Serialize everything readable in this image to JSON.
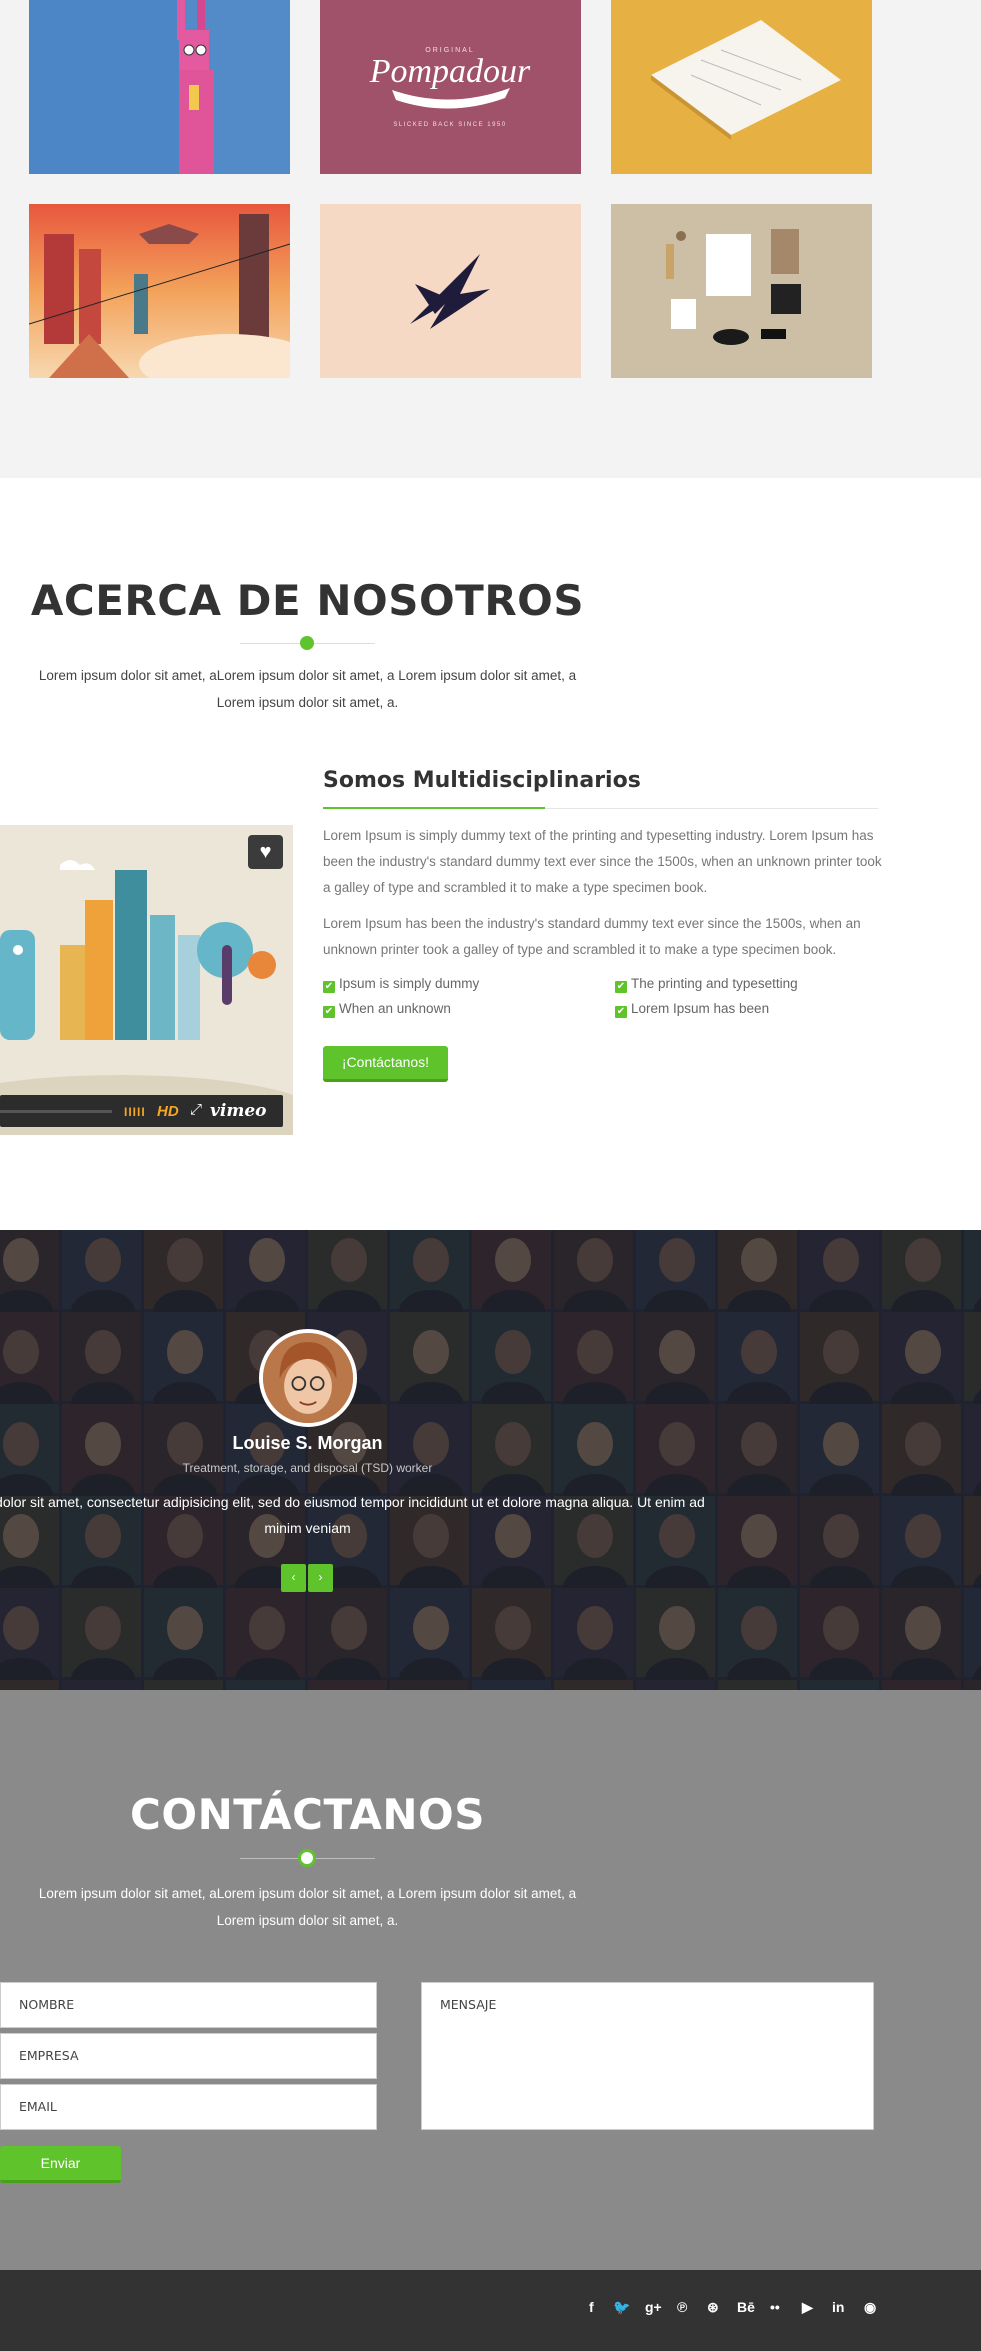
{
  "portfolio": {
    "tiles": [
      {
        "caption": ""
      },
      {
        "logo_small": "ORIGINAL",
        "logo_main": "Pompadour",
        "logo_sub": "SLICKED BACK SINCE 1950"
      },
      {
        "caption": ""
      },
      {
        "caption": ""
      },
      {
        "caption": ""
      },
      {
        "caption": ""
      }
    ]
  },
  "about": {
    "title": "ACERCA DE NOSOTROS",
    "intro": "Lorem ipsum dolor sit amet, aLorem ipsum dolor sit amet, a Lorem ipsum dolor sit amet, a Lorem ipsum dolor sit amet, a.",
    "subtitle": "Somos Multidisciplinarios",
    "paragraph1": "Lorem Ipsum is simply dummy text of the printing and typesetting industry. Lorem Ipsum has been the industry's standard dummy text ever since the 1500s, when an unknown printer took a galley of type and scrambled it to make a type specimen book.",
    "paragraph2": "Lorem Ipsum has been the industry's standard dummy text ever since the 1500s, when an unknown printer took a galley of type and scrambled it to make a type specimen book.",
    "checklist": [
      "Ipsum is simply dummy",
      "The printing and typesetting",
      "When an unknown",
      "Lorem Ipsum has been"
    ],
    "cta_label": "¡Contáctanos!",
    "video": {
      "hd_label": "HD",
      "brand": "vimeo"
    }
  },
  "testimonials": {
    "name": "Louise S. Morgan",
    "role": "Treatment, storage, and disposal (TSD) worker",
    "quote": "Lorem ipsum dolor sit amet, consectetur adipisicing elit, sed do eiusmod tempor incididunt ut et dolore magna aliqua. Ut enim ad minim veniam",
    "prev_icon": "‹",
    "next_icon": "›"
  },
  "contact": {
    "title": "CONTÁCTANOS",
    "intro": "Lorem ipsum dolor sit amet, aLorem ipsum dolor sit amet, a Lorem ipsum dolor sit amet, a Lorem ipsum dolor sit amet, a.",
    "name_placeholder": "NOMBRE",
    "company_placeholder": "EMPRESA",
    "email_placeholder": "EMAIL",
    "message_placeholder": "MENSAJE",
    "send_label": "Enviar"
  },
  "footer": {
    "social": [
      {
        "icon": "facebook-icon",
        "glyph": "f"
      },
      {
        "icon": "twitter-icon",
        "glyph": "🐦"
      },
      {
        "icon": "google-plus-icon",
        "glyph": "g+"
      },
      {
        "icon": "pinterest-icon",
        "glyph": "℗"
      },
      {
        "icon": "dribbble-icon",
        "glyph": "⊛"
      },
      {
        "icon": "behance-icon",
        "glyph": "Bē"
      },
      {
        "icon": "flickr-icon",
        "glyph": "••"
      },
      {
        "icon": "youtube-icon",
        "glyph": "▶"
      },
      {
        "icon": "linkedin-icon",
        "glyph": "in"
      },
      {
        "icon": "github-icon",
        "glyph": "◉"
      }
    ]
  },
  "colors": {
    "accent": "#5fc32b",
    "footer_bg": "#333333",
    "contact_bg": "#8a8a8a",
    "testimonial_bg": "#252838"
  }
}
